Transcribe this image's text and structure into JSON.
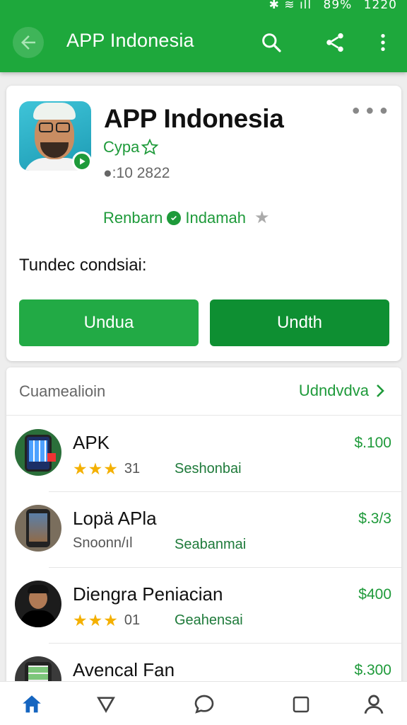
{
  "status_bar": {
    "icons": "✱ ≋ ıll",
    "battery": "89%",
    "time": "1220"
  },
  "appbar": {
    "title": "APP Indonesia",
    "icons": [
      "back-arrow-icon",
      "search-icon",
      "share-icon",
      "more-vert-icon"
    ]
  },
  "app_card": {
    "name": "APP Indonesia",
    "subtitle": "Cypa",
    "meta": "●:10 2822",
    "developer_left": "Renbarn",
    "developer_right": "Indamah",
    "condition": "Tundec condsiai:",
    "buttons": {
      "left": "Undua",
      "right": "Undth"
    }
  },
  "list": {
    "title": "Cuamealioin",
    "link": "Udndvdva",
    "items": [
      {
        "title": "APK",
        "stars": "★★★",
        "sub": "31",
        "tag": "Seshonbai",
        "price": "$.100"
      },
      {
        "title": "Lopä APla",
        "stars": "",
        "sub": "Snoonn/ıl",
        "tag": "Seabanmai",
        "price": "$.3/3"
      },
      {
        "title": "Diengra Peniacian",
        "stars": "★★★",
        "sub": "01",
        "tag": "Geahensai",
        "price": "$400"
      },
      {
        "title": "Avencal Fan",
        "stars": "",
        "sub": "",
        "tag": "",
        "price": "$.300"
      }
    ]
  },
  "colors": {
    "primary": "#1ea83c",
    "button_left": "#22aa45",
    "button_right": "#0e8f32",
    "star": "#f4b000"
  },
  "bottom_nav": [
    "home-icon",
    "triangle-down-icon",
    "chat-icon",
    "square-icon",
    "person-icon"
  ]
}
